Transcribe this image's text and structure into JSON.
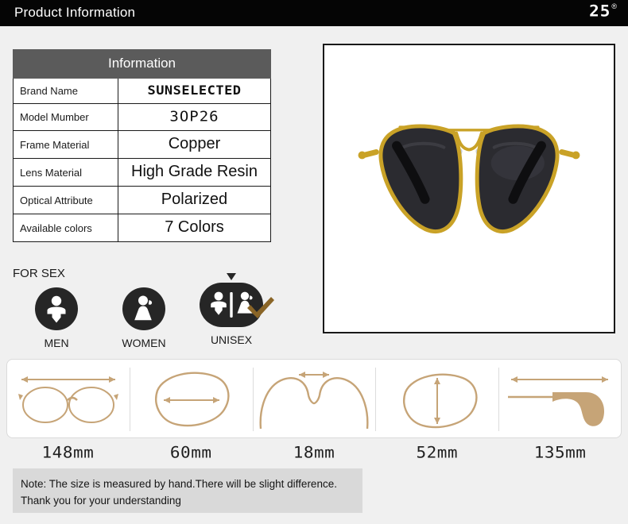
{
  "header": {
    "title": "Product Information",
    "logo_text": "25",
    "logo_registered": "®"
  },
  "info_table": {
    "header": "Information",
    "rows": [
      {
        "label": "Brand Name",
        "value": "SUNSELECTED",
        "style": "digital-bold"
      },
      {
        "label": "Model Mumber",
        "value": "3OP26",
        "style": "digital"
      },
      {
        "label": "Frame Material",
        "value": "Copper",
        "style": "plain"
      },
      {
        "label": "Lens Material",
        "value": "High Grade Resin",
        "style": "plain"
      },
      {
        "label": "Optical Attribute",
        "value": "Polarized",
        "style": "plain"
      },
      {
        "label": "Available colors",
        "value": "7 Colors",
        "style": "plain"
      }
    ]
  },
  "for_sex": {
    "label": "FOR SEX",
    "options": [
      {
        "caption": "MEN",
        "icon": "male-figure-icon",
        "selected": false
      },
      {
        "caption": "WOMEN",
        "icon": "female-figure-icon",
        "selected": false
      },
      {
        "caption": "UNISEX",
        "icon": "male-female-figures-icon",
        "selected": true
      }
    ],
    "selected_marker": "checkmark-icon"
  },
  "product_image": {
    "alt": "aviator-sunglasses",
    "frame_color": "#C9A227",
    "lens_color": "#2b2b30"
  },
  "measurements": [
    {
      "icon": "glasses-front-width-icon",
      "label": "148mm"
    },
    {
      "icon": "lens-width-icon",
      "label": "60mm"
    },
    {
      "icon": "bridge-width-icon",
      "label": "18mm"
    },
    {
      "icon": "lens-height-icon",
      "label": "52mm"
    },
    {
      "icon": "temple-arm-length-icon",
      "label": "135mm"
    }
  ],
  "note": {
    "line1": "Note: The size is measured by hand.There will be slight difference.",
    "line2": "Thank you for your understanding"
  },
  "colors": {
    "header_bg": "#050505",
    "table_header_bg": "#5b5b5b",
    "measure_accent": "#c6a477",
    "check_gold": "#8a6527",
    "note_bg": "#d9d9d9"
  }
}
